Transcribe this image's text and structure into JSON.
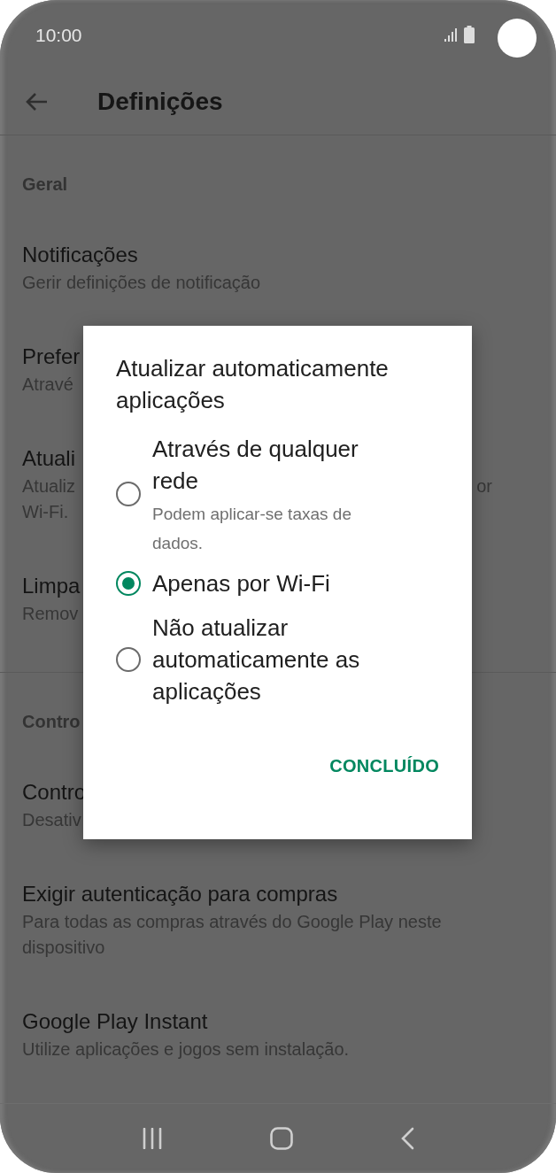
{
  "status_bar": {
    "time": "10:00"
  },
  "app_bar": {
    "title": "Definições"
  },
  "sections": [
    {
      "header": "Geral",
      "items": [
        {
          "title": "Notificações",
          "subtitle_lines": [
            "Gerir definições de notificação"
          ]
        },
        {
          "title": "Prefer",
          "subtitle_lines": [
            "Atravé"
          ]
        },
        {
          "title": "Atuali",
          "subtitle_lines": [
            "Atualiz",
            "Wi-Fi."
          ],
          "subtitle_tail": "or"
        },
        {
          "title": "Limpa",
          "subtitle_lines": [
            "Remov"
          ]
        }
      ]
    },
    {
      "header": "Contro",
      "items": [
        {
          "title": "Contro",
          "subtitle_lines": [
            "Desativ"
          ]
        },
        {
          "title": "Exigir autenticação para compras",
          "subtitle": "Para todas as compras através do Google Play neste dispositivo"
        },
        {
          "title": "Google Play Instant",
          "subtitle": "Utilize aplicações e jogos sem instalação."
        }
      ]
    }
  ],
  "dialog": {
    "title": "Atualizar automaticamente aplicações",
    "options": [
      {
        "label": "Através de qualquer rede",
        "description": "Podem aplicar-se taxas de dados.",
        "selected": false
      },
      {
        "label": "Apenas por Wi-Fi",
        "selected": true
      },
      {
        "label": "Não atualizar automaticamente as aplicações",
        "selected": false
      }
    ],
    "button": "CONCLUÍDO"
  }
}
